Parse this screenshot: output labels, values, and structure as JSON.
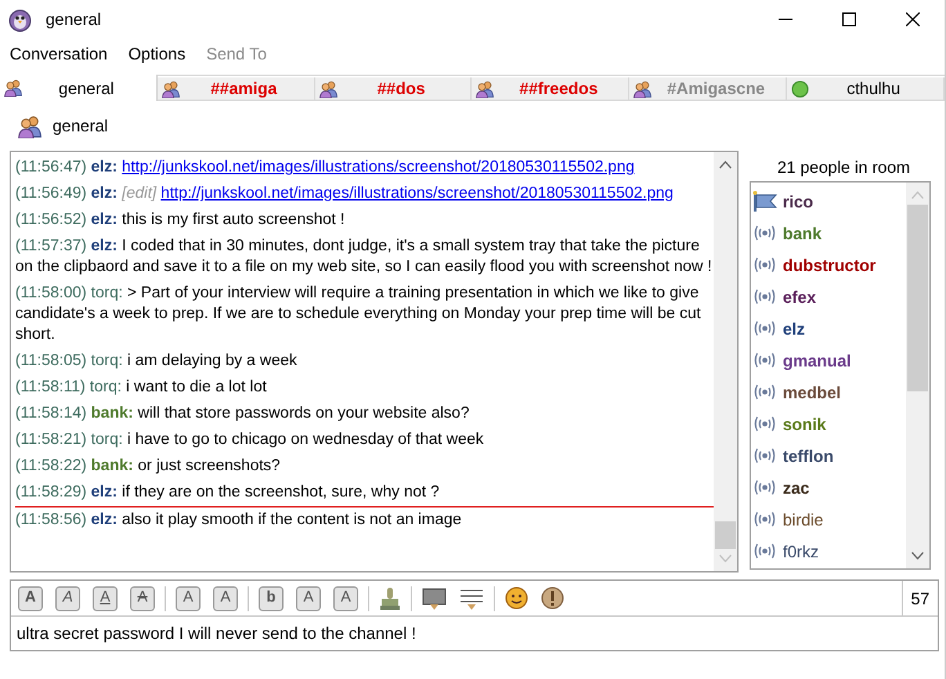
{
  "window": {
    "title": "general"
  },
  "menu": [
    {
      "label": "Conversation",
      "disabled": false
    },
    {
      "label": "Options",
      "disabled": false
    },
    {
      "label": "Send To",
      "disabled": true
    }
  ],
  "tabs": [
    {
      "label": "general",
      "kind": "group",
      "color": "#000000",
      "bold": false,
      "selected": true
    },
    {
      "label": "##amiga",
      "kind": "group",
      "color": "#dd0000",
      "bold": true,
      "selected": false
    },
    {
      "label": "##dos",
      "kind": "group",
      "color": "#dd0000",
      "bold": true,
      "selected": false
    },
    {
      "label": "##freedos",
      "kind": "group",
      "color": "#dd0000",
      "bold": true,
      "selected": false
    },
    {
      "label": "#Amigascne",
      "kind": "group",
      "color": "#888888",
      "bold": true,
      "selected": false
    },
    {
      "label": "cthulhu",
      "kind": "buddy",
      "color": "#000000",
      "bold": false,
      "selected": false
    }
  ],
  "conversation": {
    "title": "general"
  },
  "messages": [
    {
      "time": "(11:56:47)",
      "nick": "elz:",
      "color": "#1f3f7a",
      "nick_bold": true,
      "link": "http://junkskool.net/images/illustrations/screenshot/20180530115502.png",
      "last_read": false
    },
    {
      "time": "(11:56:49)",
      "nick": "elz:",
      "color": "#1f3f7a",
      "nick_bold": true,
      "edited": "[edit]",
      "link": "http://junkskool.net/images/illustrations/screenshot/20180530115502.png",
      "last_read": false
    },
    {
      "time": "(11:56:52)",
      "nick": "elz:",
      "color": "#1f3f7a",
      "nick_bold": true,
      "text": "this is my first auto screenshot !",
      "last_read": false
    },
    {
      "time": "(11:57:37)",
      "nick": "elz:",
      "color": "#1f3f7a",
      "nick_bold": true,
      "text": "I coded that in 30 minutes, dont judge, it's a small system tray that take the picture on the clipbaord and save it to a file on my web site, so I can easily flood you with screenshot now !",
      "last_read": false
    },
    {
      "time": "(11:58:00)",
      "nick": "torq:",
      "color": "#3d6b5e",
      "nick_bold": false,
      "text": "> Part of your interview will require a training presentation in which we like to give candidate's a week to prep. If we are to schedule everything on Monday your prep time will be cut short.",
      "last_read": false
    },
    {
      "time": "(11:58:05)",
      "nick": "torq:",
      "color": "#3d6b5e",
      "nick_bold": false,
      "text": "i am delaying by a week",
      "last_read": false
    },
    {
      "time": "(11:58:11)",
      "nick": "torq:",
      "color": "#3d6b5e",
      "nick_bold": false,
      "text": "i want to die a lot lot",
      "last_read": false
    },
    {
      "time": "(11:58:14)",
      "nick": "bank:",
      "color": "#4e7a2c",
      "nick_bold": true,
      "text": "will that store passwords on your website also?",
      "last_read": false
    },
    {
      "time": "(11:58:21)",
      "nick": "torq:",
      "color": "#3d6b5e",
      "nick_bold": false,
      "text": "i have to go to chicago on wednesday of that week",
      "last_read": false
    },
    {
      "time": "(11:58:22)",
      "nick": "bank:",
      "color": "#4e7a2c",
      "nick_bold": true,
      "text": "or just screenshots?",
      "last_read": false
    },
    {
      "time": "(11:58:29)",
      "nick": "elz:",
      "color": "#1f3f7a",
      "nick_bold": true,
      "text": "if they are on the screenshot, sure, why not ?",
      "last_read": true
    },
    {
      "time": "(11:58:56)",
      "nick": "elz:",
      "color": "#1f3f7a",
      "nick_bold": true,
      "text": "also it play smooth if the content is not an image",
      "last_read": false
    }
  ],
  "room": {
    "count_label": "21 people in room",
    "users": [
      {
        "name": "rico",
        "kind": "op",
        "color": "#4a2a4a",
        "bold": true
      },
      {
        "name": "bank",
        "kind": "voice",
        "color": "#4e7a2c",
        "bold": true
      },
      {
        "name": "dubstructor",
        "kind": "voice",
        "color": "#a00000",
        "bold": true
      },
      {
        "name": "efex",
        "kind": "voice",
        "color": "#5a1f5a",
        "bold": true
      },
      {
        "name": "elz",
        "kind": "voice",
        "color": "#1f3f7a",
        "bold": true
      },
      {
        "name": "gmanual",
        "kind": "voice",
        "color": "#6a3a8a",
        "bold": true
      },
      {
        "name": "medbel",
        "kind": "voice",
        "color": "#6a4a3a",
        "bold": true
      },
      {
        "name": "sonik",
        "kind": "voice",
        "color": "#5a7a1a",
        "bold": true
      },
      {
        "name": "tefflon",
        "kind": "voice",
        "color": "#3a4a6a",
        "bold": true
      },
      {
        "name": "zac",
        "kind": "voice",
        "color": "#3a2a1a",
        "bold": true
      },
      {
        "name": "birdie",
        "kind": "voice",
        "color": "#6a4a2a",
        "bold": false
      },
      {
        "name": "f0rkz",
        "kind": "voice",
        "color": "#3a4a6a",
        "bold": false
      }
    ]
  },
  "compose": {
    "format_buttons": [
      {
        "glyph": "A",
        "kind": "bold"
      },
      {
        "glyph": "A",
        "kind": "italic"
      },
      {
        "glyph": "A",
        "kind": "underline"
      },
      {
        "glyph": "A",
        "kind": "strike"
      },
      {
        "glyph": "A",
        "kind": "grow"
      },
      {
        "glyph": "A",
        "kind": "shrink"
      },
      {
        "glyph": "b",
        "kind": "font"
      },
      {
        "glyph": "A",
        "kind": "fg"
      },
      {
        "glyph": "A",
        "kind": "bg"
      }
    ],
    "char_count": "57",
    "value": "ultra secret password I will never send to the channel !"
  }
}
